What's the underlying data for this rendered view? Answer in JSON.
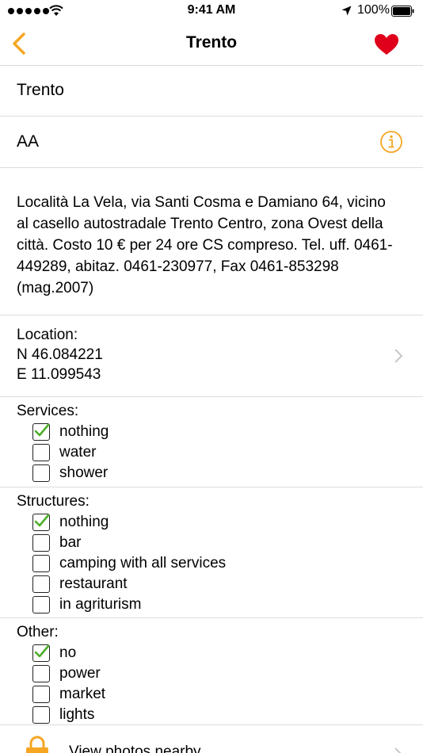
{
  "status_bar": {
    "time": "9:41 AM",
    "battery_percent": "100%"
  },
  "nav": {
    "title": "Trento"
  },
  "fields": {
    "name": "Trento",
    "category": "AA",
    "description": "Località La Vela, via Santi Cosma e Damiano 64, vicino al casello autostradale Trento Centro, zona Ovest della città. Costo 10 € per 24 ore CS compreso. Tel. uff. 0461-449289, abitaz. 0461-230977, Fax 0461-853298 (mag.2007)"
  },
  "location": {
    "label": "Location:",
    "lat": "N 46.084221",
    "lon": "E 11.099543"
  },
  "services": {
    "title": "Services:",
    "options": [
      {
        "label": "nothing",
        "checked": true
      },
      {
        "label": "water",
        "checked": false
      },
      {
        "label": "shower",
        "checked": false
      }
    ]
  },
  "structures": {
    "title": "Structures:",
    "options": [
      {
        "label": "nothing",
        "checked": true
      },
      {
        "label": "bar",
        "checked": false
      },
      {
        "label": "camping with all services",
        "checked": false
      },
      {
        "label": "restaurant",
        "checked": false
      },
      {
        "label": "in agriturism",
        "checked": false
      }
    ]
  },
  "other": {
    "title": "Other:",
    "options": [
      {
        "label": "no",
        "checked": true
      },
      {
        "label": "power",
        "checked": false
      },
      {
        "label": "market",
        "checked": false
      },
      {
        "label": "lights",
        "checked": false
      }
    ]
  },
  "photos": {
    "label": "View photos nearby"
  },
  "colors": {
    "accent": "#f5a623",
    "favorite": "#e0001b",
    "check": "#4caf2a"
  }
}
